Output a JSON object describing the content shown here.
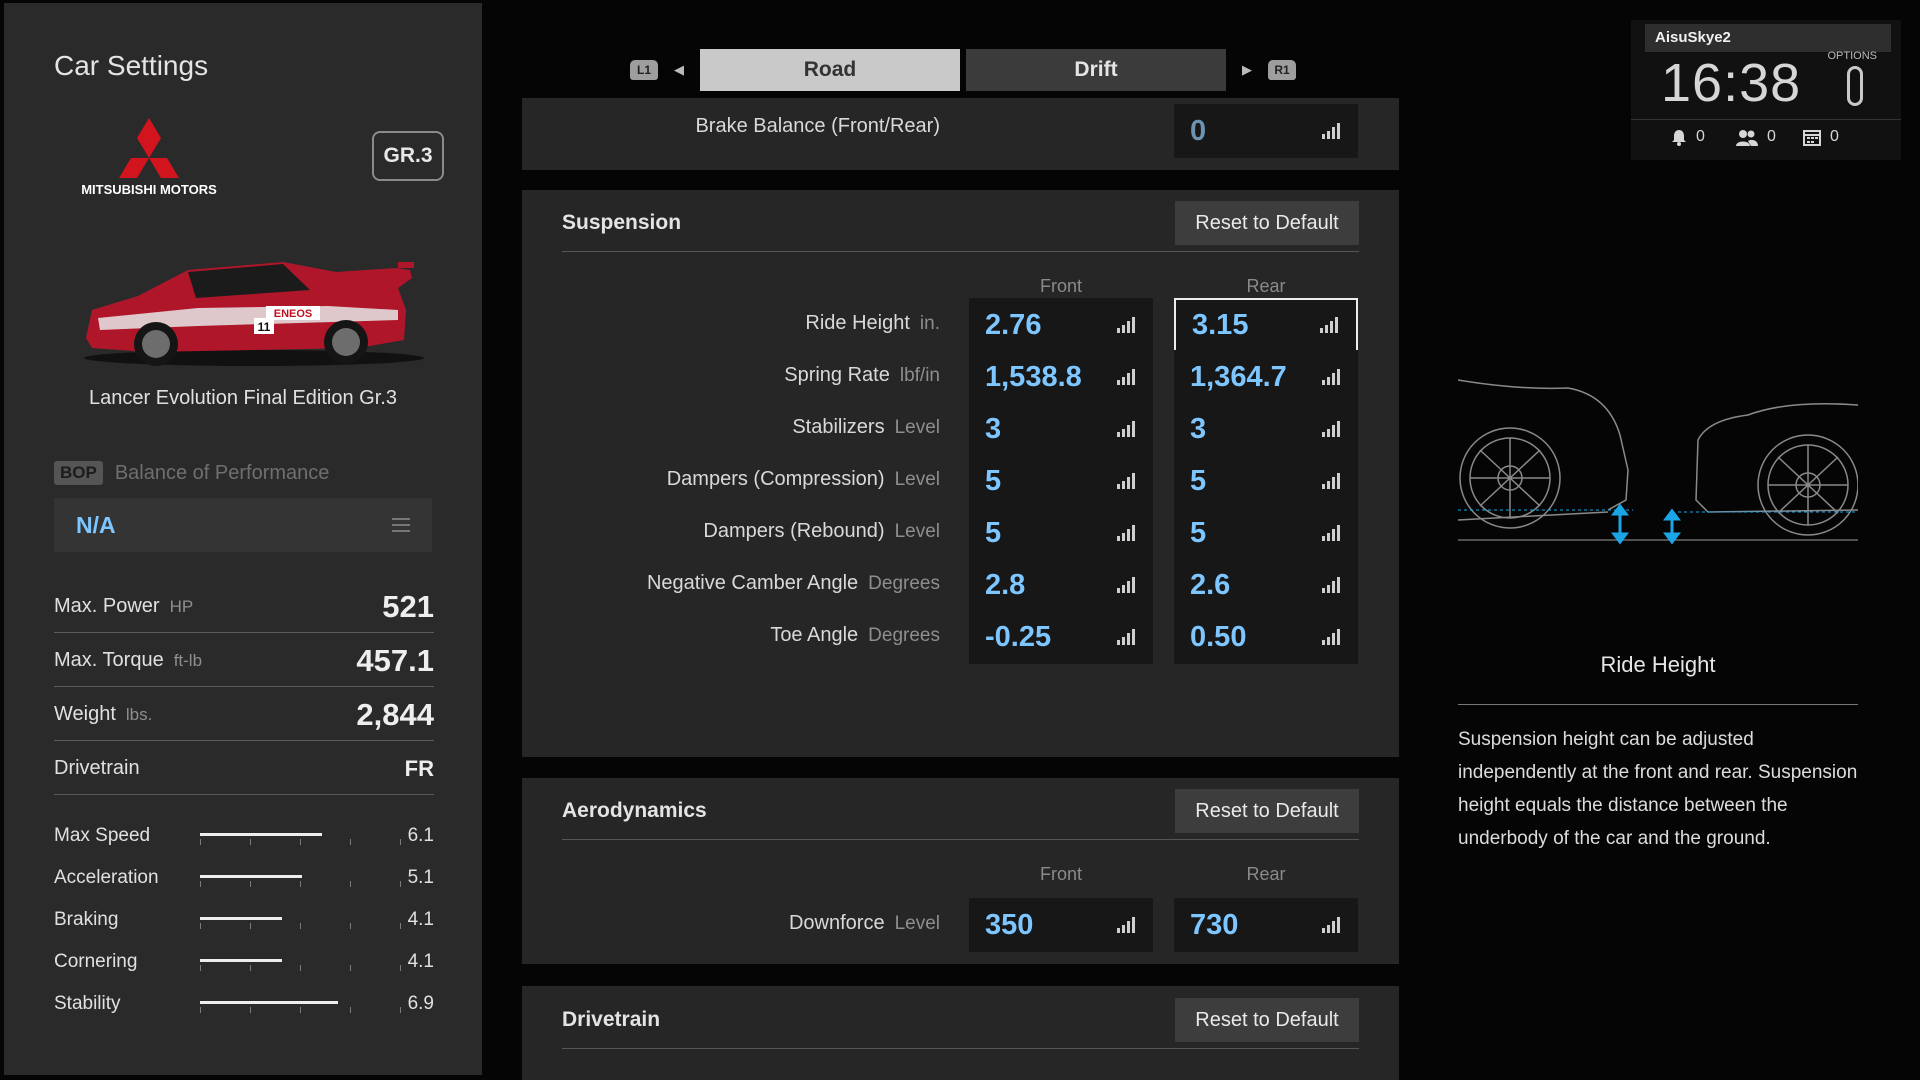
{
  "page": {
    "title": "Car Settings"
  },
  "car": {
    "manufacturer": "MITSUBISHI MOTORS",
    "category": "GR.3",
    "name": "Lancer Evolution Final Edition Gr.3",
    "livery_text": "ENEOS",
    "car_number": "11"
  },
  "bop": {
    "tag": "BOP",
    "label": "Balance of Performance",
    "value": "N/A"
  },
  "specs": {
    "power": {
      "label": "Max. Power",
      "unit": "HP",
      "value": "521"
    },
    "torque": {
      "label": "Max. Torque",
      "unit": "ft-lb",
      "value": "457.1"
    },
    "weight": {
      "label": "Weight",
      "unit": "lbs.",
      "value": "2,844"
    },
    "drivetrain": {
      "label": "Drivetrain",
      "value": "FR"
    }
  },
  "stats": [
    {
      "label": "Max Speed",
      "value": "6.1",
      "level": 6.1
    },
    {
      "label": "Acceleration",
      "value": "5.1",
      "level": 5.1
    },
    {
      "label": "Braking",
      "value": "4.1",
      "level": 4.1
    },
    {
      "label": "Cornering",
      "value": "4.1",
      "level": 4.1
    },
    {
      "label": "Stability",
      "value": "6.9",
      "level": 6.9
    }
  ],
  "stats_max": 10,
  "tabs": {
    "left_button": "L1",
    "right_button": "R1",
    "items": [
      {
        "label": "Road",
        "active": true
      },
      {
        "label": "Drift",
        "active": false
      }
    ]
  },
  "brake": {
    "label": "Brake Balance (Front/Rear)",
    "value": "0"
  },
  "suspension": {
    "title": "Suspension",
    "reset_label": "Reset to Default",
    "col_front": "Front",
    "col_rear": "Rear",
    "rows": [
      {
        "label": "Ride Height",
        "unit": "in.",
        "front": "2.76",
        "rear": "3.15"
      },
      {
        "label": "Spring Rate",
        "unit": "lbf/in",
        "front": "1,538.8",
        "rear": "1,364.7"
      },
      {
        "label": "Stabilizers",
        "unit": "Level",
        "front": "3",
        "rear": "3"
      },
      {
        "label": "Dampers (Compression)",
        "unit": "Level",
        "front": "5",
        "rear": "5"
      },
      {
        "label": "Dampers (Rebound)",
        "unit": "Level",
        "front": "5",
        "rear": "5"
      },
      {
        "label": "Negative Camber Angle",
        "unit": "Degrees",
        "front": "2.8",
        "rear": "2.6"
      },
      {
        "label": "Toe Angle",
        "unit": "Degrees",
        "front": "-0.25",
        "rear": "0.50"
      }
    ]
  },
  "aero": {
    "title": "Aerodynamics",
    "reset_label": "Reset to Default",
    "col_front": "Front",
    "col_rear": "Rear",
    "downforce": {
      "label": "Downforce",
      "unit": "Level",
      "front": "350",
      "rear": "730"
    }
  },
  "drivetrain_section": {
    "title": "Drivetrain",
    "reset_label": "Reset to Default"
  },
  "user": {
    "name": "AisuSkye2",
    "time": "16:38",
    "options_label": "OPTIONS",
    "notifications": "0",
    "friends": "0",
    "events": "0"
  },
  "info": {
    "title": "Ride Height",
    "text": "Suspension height can be adjusted independently at the front and rear. Suspension height equals the distance between the underbody of the car and the ground."
  },
  "colors": {
    "value_blue": "#7ec6ff",
    "livery_red": "#b0162a",
    "diagram_cyan": "#1aa6e6"
  }
}
